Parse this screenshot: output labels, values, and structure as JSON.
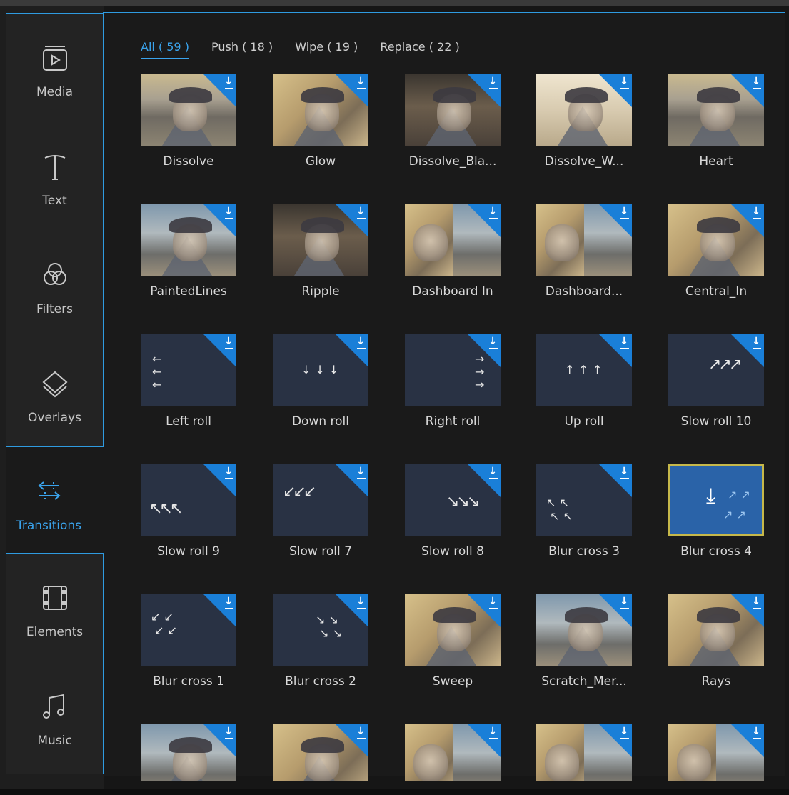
{
  "sidebar": {
    "items": [
      {
        "label": "Media",
        "icon": "media-icon"
      },
      {
        "label": "Text",
        "icon": "text-icon"
      },
      {
        "label": "Filters",
        "icon": "filters-icon"
      },
      {
        "label": "Overlays",
        "icon": "overlays-icon"
      },
      {
        "label": "Transitions",
        "icon": "transitions-icon",
        "active": true
      },
      {
        "label": "Elements",
        "icon": "elements-icon"
      },
      {
        "label": "Music",
        "icon": "music-icon"
      }
    ]
  },
  "tabs": [
    {
      "label": "All ( 59 )",
      "active": true
    },
    {
      "label": "Push ( 18 )"
    },
    {
      "label": "Wipe ( 19 )"
    },
    {
      "label": "Replace ( 22 )"
    }
  ],
  "transitions": [
    {
      "label": "Dissolve"
    },
    {
      "label": "Glow"
    },
    {
      "label": "Dissolve_Bla..."
    },
    {
      "label": "Dissolve_W..."
    },
    {
      "label": "Heart"
    },
    {
      "label": "PaintedLines"
    },
    {
      "label": "Ripple"
    },
    {
      "label": "Dashboard In"
    },
    {
      "label": "Dashboard..."
    },
    {
      "label": "Central_In"
    },
    {
      "label": "Left roll"
    },
    {
      "label": "Down roll"
    },
    {
      "label": "Right roll"
    },
    {
      "label": "Up roll"
    },
    {
      "label": "Slow roll 10"
    },
    {
      "label": "Slow roll 9"
    },
    {
      "label": "Slow roll 7"
    },
    {
      "label": "Slow roll 8"
    },
    {
      "label": "Blur cross 3"
    },
    {
      "label": "Blur cross 4",
      "selected": true
    },
    {
      "label": "Blur cross 1"
    },
    {
      "label": "Blur cross 2"
    },
    {
      "label": "Sweep"
    },
    {
      "label": "Scratch_Mer..."
    },
    {
      "label": "Rays"
    },
    {
      "label": ""
    },
    {
      "label": ""
    },
    {
      "label": ""
    },
    {
      "label": ""
    },
    {
      "label": ""
    }
  ],
  "colors": {
    "accent": "#3aa3ec",
    "download_badge": "#1a7fd8",
    "selection_border": "#c6b84a"
  }
}
